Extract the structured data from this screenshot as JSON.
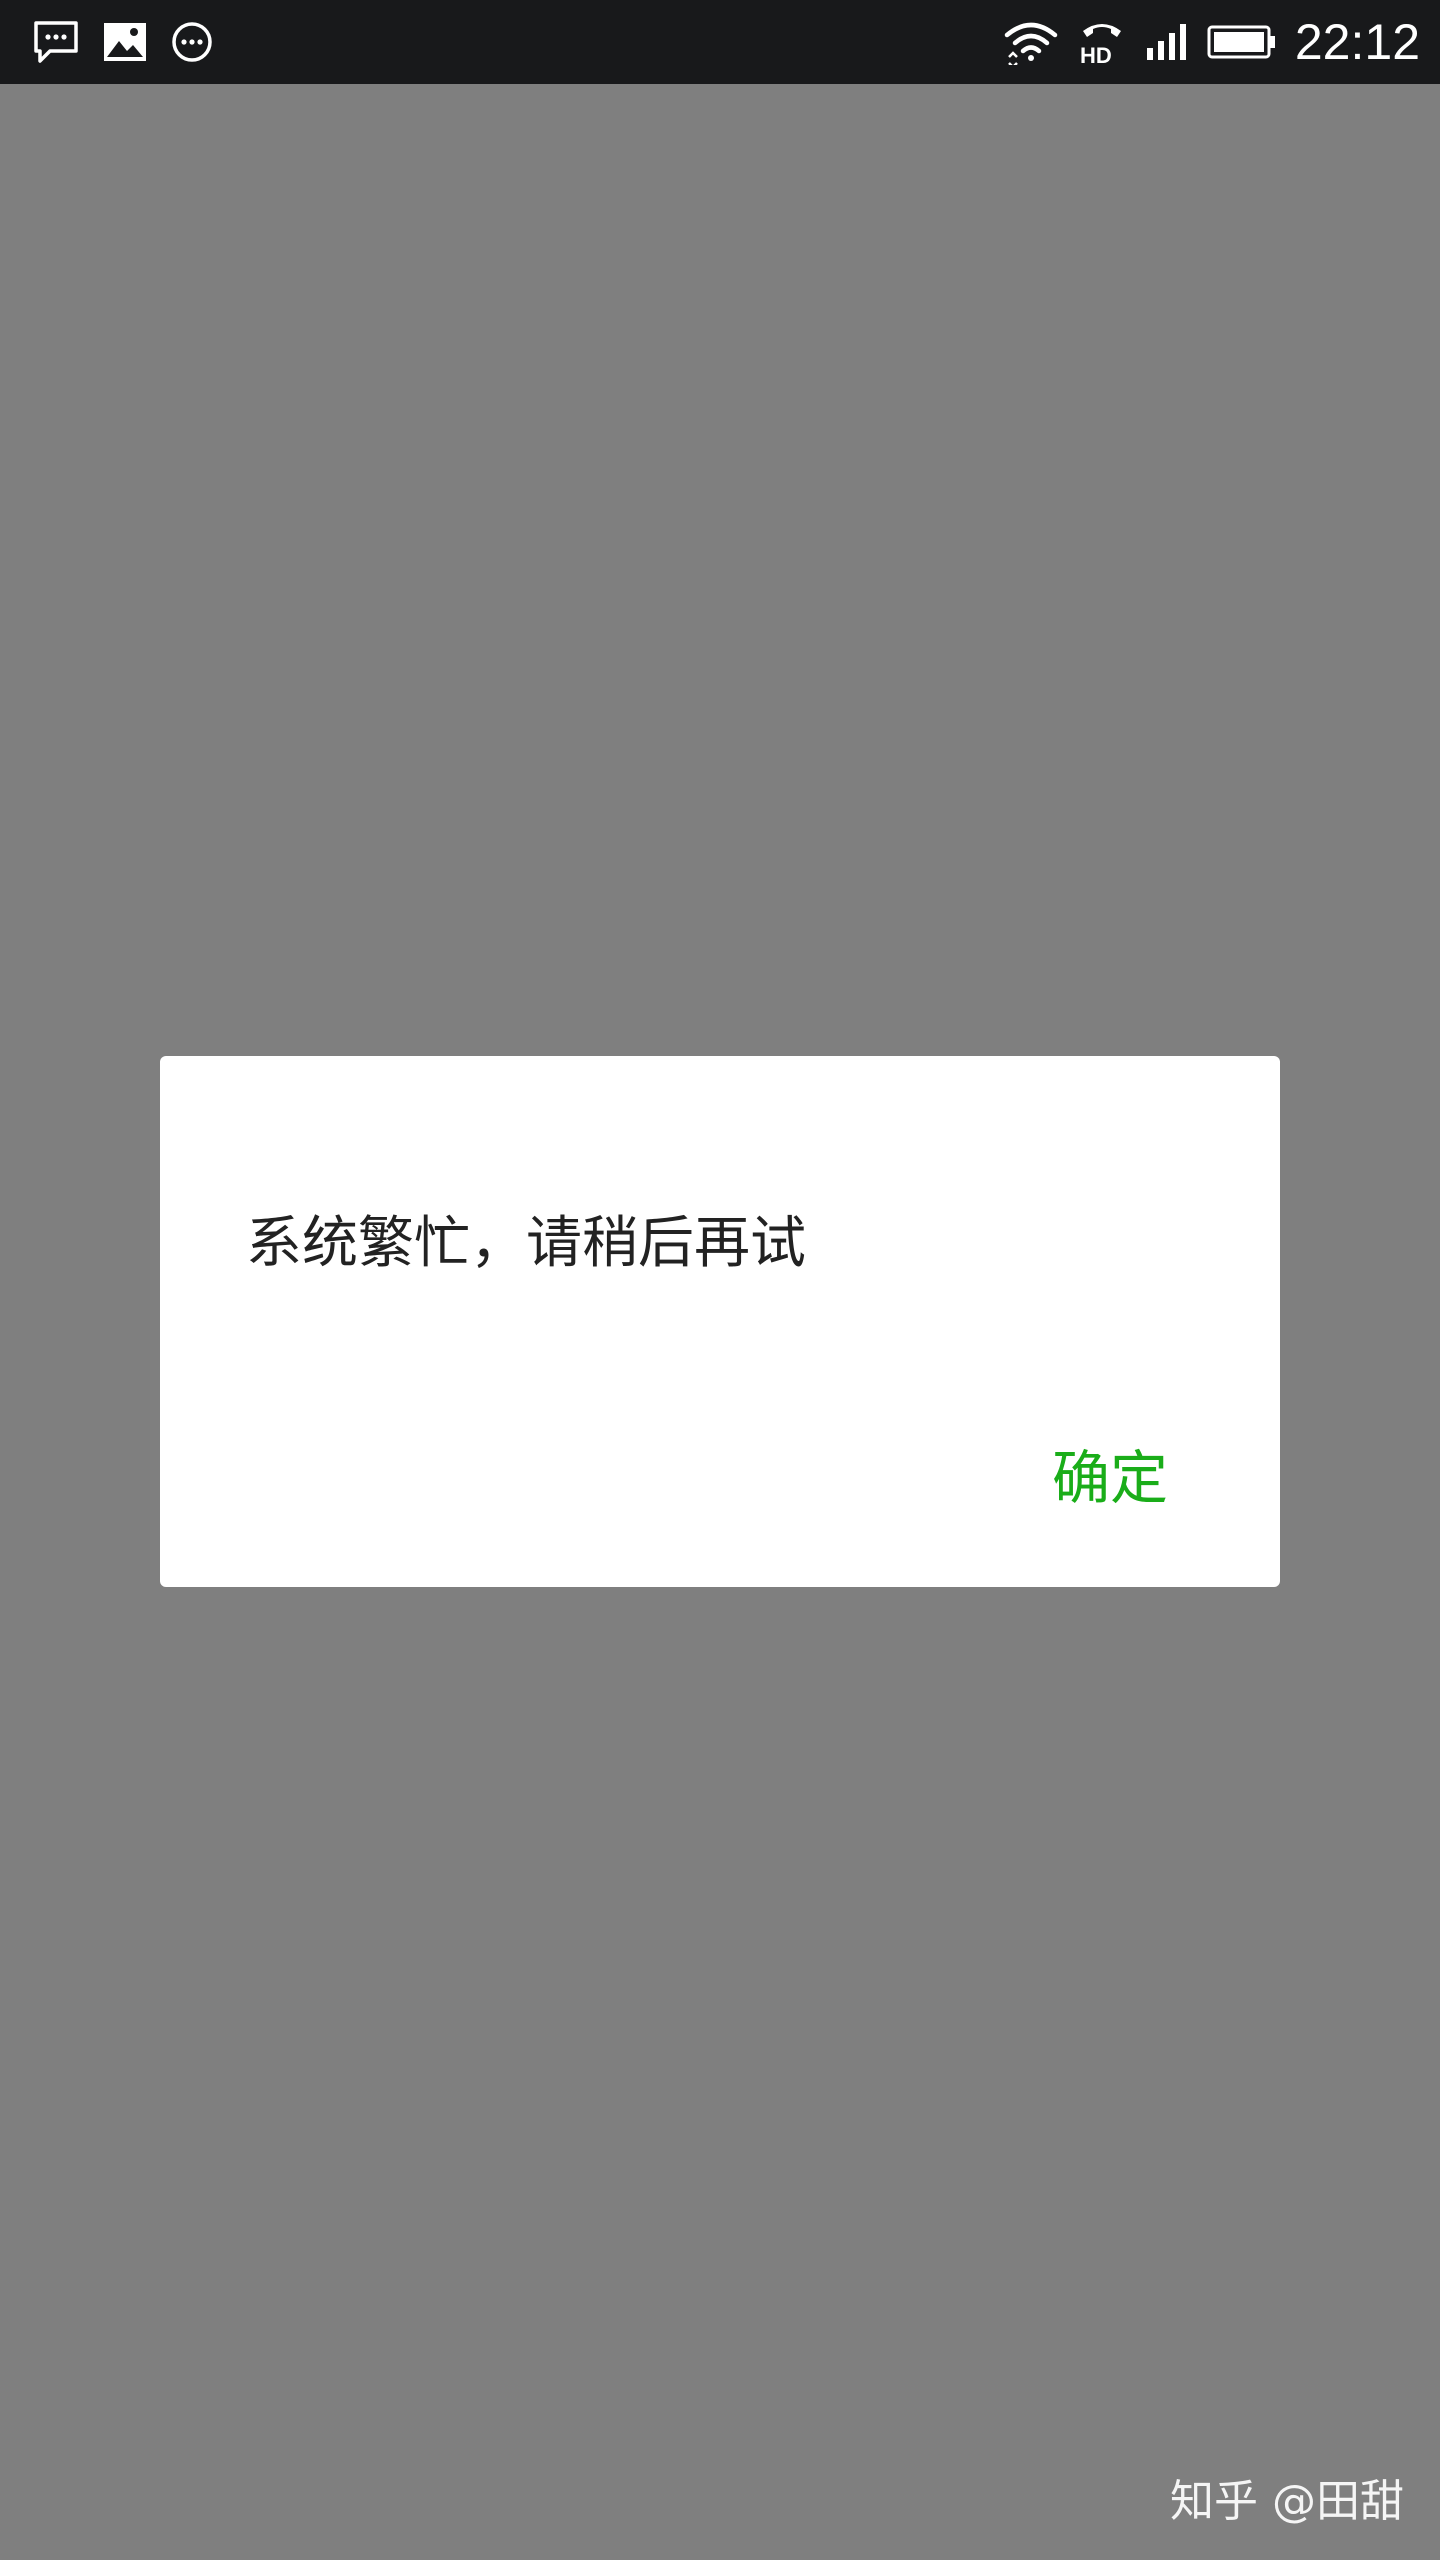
{
  "status_bar": {
    "time": "22:12",
    "network_label": "HD",
    "left_icons": [
      "message-icon",
      "image-icon",
      "more-icon"
    ],
    "right_icons": [
      "wifi-icon",
      "hd-call-icon",
      "signal-icon",
      "battery-icon"
    ]
  },
  "dialog": {
    "message": "系统繁忙，请稍后再试",
    "confirm_label": "确定",
    "confirm_color": "#1aad19"
  },
  "watermark": {
    "text": "知乎 @田甜"
  },
  "colors": {
    "overlay": "#7f7f7f",
    "status_bar": "#18191b",
    "dialog_bg": "#ffffff"
  }
}
